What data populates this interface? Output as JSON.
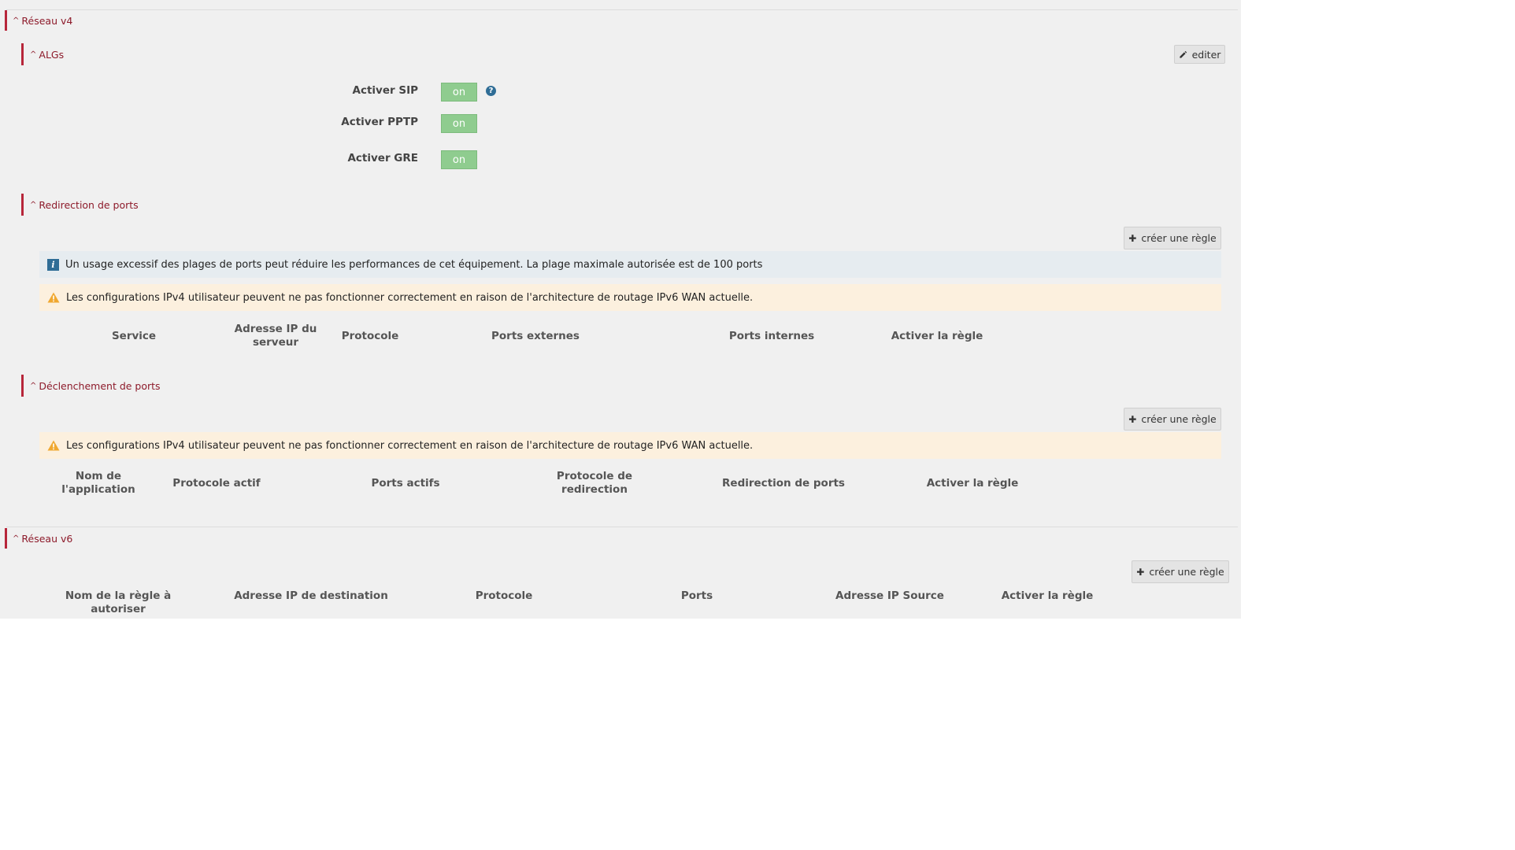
{
  "reseau_v4": {
    "title": "Réseau v4",
    "algs": {
      "title": "ALGs",
      "edit_label": "editer",
      "rows": [
        {
          "label": "Activer SIP",
          "value": "on",
          "help": true
        },
        {
          "label": "Activer PPTP",
          "value": "on"
        },
        {
          "label": "Activer GRE",
          "value": "on"
        }
      ]
    },
    "redirection": {
      "title": "Redirection de ports",
      "create_label": "créer une règle",
      "info": "Un usage excessif des plages de ports peut réduire les performances de cet équipement. La plage maximale autorisée est de 100 ports",
      "warning": "Les configurations IPv4 utilisateur peuvent ne pas fonctionner correctement en raison de l'architecture de routage IPv6 WAN actuelle.",
      "columns": [
        "Service",
        "Adresse IP du serveur",
        "Protocole",
        "Ports externes",
        "Ports internes",
        "Activer la règle"
      ]
    },
    "declenchement": {
      "title": "Déclenchement de ports",
      "create_label": "créer une règle",
      "warning": "Les configurations IPv4 utilisateur peuvent ne pas fonctionner correctement en raison de l'architecture de routage IPv6 WAN actuelle.",
      "columns": [
        "Nom de l'application",
        "Protocole actif",
        "Ports actifs",
        "Protocole de redirection",
        "Redirection de ports",
        "Activer la règle"
      ]
    }
  },
  "reseau_v6": {
    "title": "Réseau v6",
    "create_label": "créer une règle",
    "columns": [
      "Nom de la règle à autoriser",
      "Adresse IP de destination",
      "Protocole",
      "Ports",
      "Adresse IP Source",
      "Activer la règle"
    ]
  },
  "icons": {
    "chevron": "chevron-up-icon",
    "edit": "pencil-icon",
    "add": "plus-icon",
    "help": "question-circle-icon",
    "info": "info-icon",
    "warning": "warning-triangle-icon"
  },
  "colors": {
    "accent": "#b7263a",
    "toggle_on": "#8fcc8f",
    "info_bg": "#e6ecf0",
    "warning_bg": "#fcf0de",
    "warning_icon": "#f0a830"
  }
}
